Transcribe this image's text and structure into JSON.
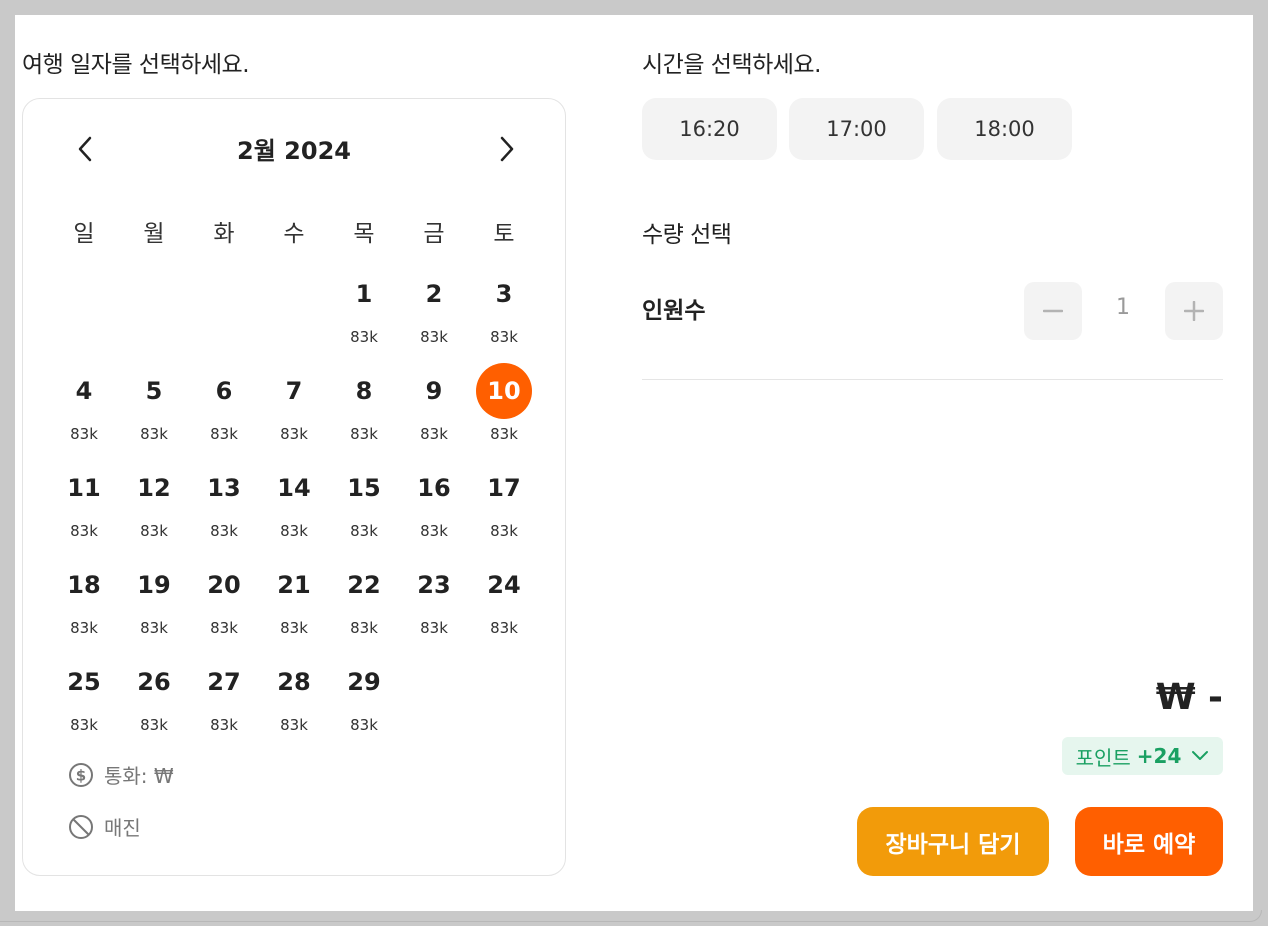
{
  "date_section": {
    "title": "여행 일자를 선택하세요."
  },
  "calendar": {
    "month_label": "2월 2024",
    "weekdays": [
      "일",
      "월",
      "화",
      "수",
      "목",
      "금",
      "토"
    ],
    "weeks": [
      [
        null,
        null,
        null,
        null,
        {
          "day": "1",
          "price": "83k"
        },
        {
          "day": "2",
          "price": "83k"
        },
        {
          "day": "3",
          "price": "83k"
        }
      ],
      [
        {
          "day": "4",
          "price": "83k"
        },
        {
          "day": "5",
          "price": "83k"
        },
        {
          "day": "6",
          "price": "83k"
        },
        {
          "day": "7",
          "price": "83k"
        },
        {
          "day": "8",
          "price": "83k"
        },
        {
          "day": "9",
          "price": "83k"
        },
        {
          "day": "10",
          "price": "83k",
          "selected": true
        }
      ],
      [
        {
          "day": "11",
          "price": "83k"
        },
        {
          "day": "12",
          "price": "83k"
        },
        {
          "day": "13",
          "price": "83k"
        },
        {
          "day": "14",
          "price": "83k"
        },
        {
          "day": "15",
          "price": "83k"
        },
        {
          "day": "16",
          "price": "83k"
        },
        {
          "day": "17",
          "price": "83k"
        }
      ],
      [
        {
          "day": "18",
          "price": "83k"
        },
        {
          "day": "19",
          "price": "83k"
        },
        {
          "day": "20",
          "price": "83k"
        },
        {
          "day": "21",
          "price": "83k"
        },
        {
          "day": "22",
          "price": "83k"
        },
        {
          "day": "23",
          "price": "83k"
        },
        {
          "day": "24",
          "price": "83k"
        }
      ],
      [
        {
          "day": "25",
          "price": "83k"
        },
        {
          "day": "26",
          "price": "83k"
        },
        {
          "day": "27",
          "price": "83k"
        },
        {
          "day": "28",
          "price": "83k"
        },
        {
          "day": "29",
          "price": "83k"
        },
        null,
        null
      ]
    ],
    "legend": {
      "currency_icon": "dollar-circle-icon",
      "currency_label": "통화: ₩",
      "soldout_icon": "prohibited-icon",
      "soldout_label": "매진"
    }
  },
  "time_section": {
    "title": "시간을 선택하세요.",
    "slots": [
      "16:20",
      "17:00",
      "18:00"
    ]
  },
  "quantity_section": {
    "title": "수량 선택",
    "label": "인원수",
    "value": "1",
    "decrement_icon": "minus-icon",
    "increment_icon": "plus-icon"
  },
  "summary": {
    "price": "₩ -",
    "points_label": "포인트",
    "points_value": "+24",
    "points_icon": "chevron-down-icon"
  },
  "actions": {
    "cart_label": "장바구니 담기",
    "book_label": "바로 예약"
  },
  "colors": {
    "accent": "#ff5f00",
    "cart_button": "#f29b0a",
    "points_bg": "#e6f6ee",
    "points_text": "#1aa062"
  }
}
